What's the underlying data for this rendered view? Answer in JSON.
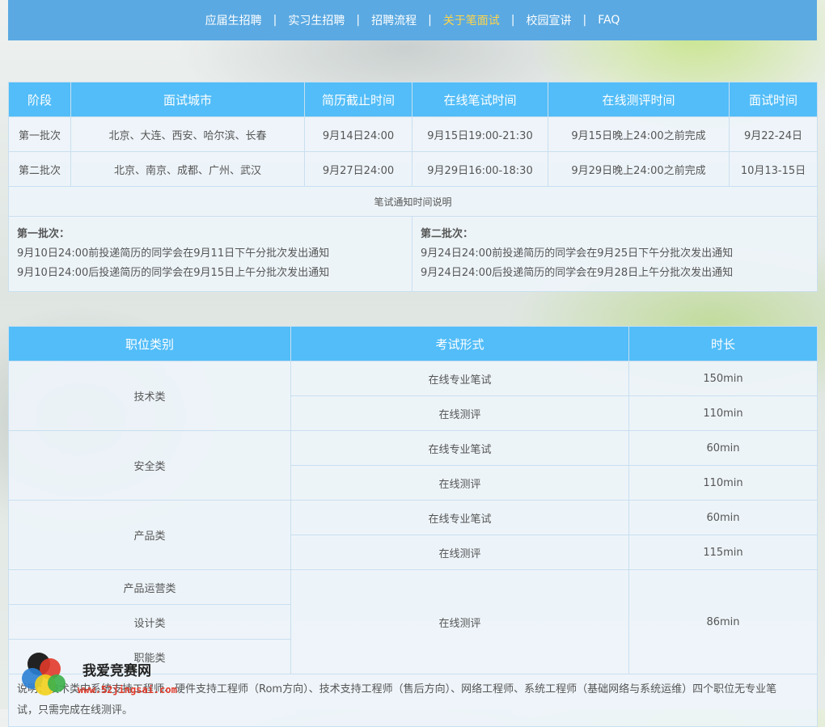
{
  "nav": {
    "items": [
      {
        "label": "应届生招聘"
      },
      {
        "label": "实习生招聘"
      },
      {
        "label": "招聘流程"
      },
      {
        "label": "关于笔面试"
      },
      {
        "label": "校园宣讲"
      },
      {
        "label": "FAQ"
      }
    ],
    "separator": "|",
    "active_index": 3,
    "active_color": "#ffd54a",
    "bar_color": "#5aa9e2"
  },
  "schedule": {
    "headers": [
      "阶段",
      "面试城市",
      "简历截止时间",
      "在线笔试时间",
      "在线测评时间",
      "面试时间"
    ],
    "rows": [
      [
        "第一批次",
        "北京、大连、西安、哈尔滨、长春",
        "9月14日24:00",
        "9月15日19:00-21:30",
        "9月15日晚上24:00之前完成",
        "9月22-24日"
      ],
      [
        "第二批次",
        "北京、南京、成都、广州、武汉",
        "9月27日24:00",
        "9月29日16:00-18:30",
        "9月29日晚上24:00之前完成",
        "10月13-15日"
      ]
    ],
    "notice_title": "笔试通知时间说明",
    "notice_left": {
      "title": "第一批次：",
      "line1": "9月10日24:00前投递简历的同学会在9月11日下午分批次发出通知",
      "line2": "9月10日24:00后投递简历的同学会在9月15日上午分批次发出通知"
    },
    "notice_right": {
      "title": "第二批次：",
      "line1": "9月24日24:00前投递简历的同学会在9月25日下午分批次发出通知",
      "line2": "9月24日24:00后投递简历的同学会在9月28日上午分批次发出通知"
    }
  },
  "exams": {
    "headers": [
      "职位类别",
      "考试形式",
      "时长"
    ],
    "groups": [
      {
        "category": "技术类",
        "rows": [
          [
            "在线专业笔试",
            "150min"
          ],
          [
            "在线测评",
            "110min"
          ]
        ]
      },
      {
        "category": "安全类",
        "rows": [
          [
            "在线专业笔试",
            "60min"
          ],
          [
            "在线测评",
            "110min"
          ]
        ]
      },
      {
        "category": "产品类",
        "rows": [
          [
            "在线专业笔试",
            "60min"
          ],
          [
            "在线测评",
            "115min"
          ]
        ]
      }
    ],
    "shared": {
      "categories": [
        "产品运营类",
        "设计类",
        "职能类"
      ],
      "form": "在线测评",
      "duration": "86min"
    },
    "footnote_line1": "说明：技术类中系统支持工程师、硬件支持工程师（Rom方向）、技术支持工程师（售后方向）、网络工程师、系统工程师（基础网络与系统运维）四个职位无专业笔",
    "footnote_line2": "试，只需完成在线测评。"
  },
  "watermark": {
    "title": "我爱竞赛网",
    "url": "www.52jingsai.com"
  },
  "colors": {
    "header_bg": "#52bdf8",
    "cell_bg": "#eef4fa",
    "border": "#c9dff0"
  }
}
